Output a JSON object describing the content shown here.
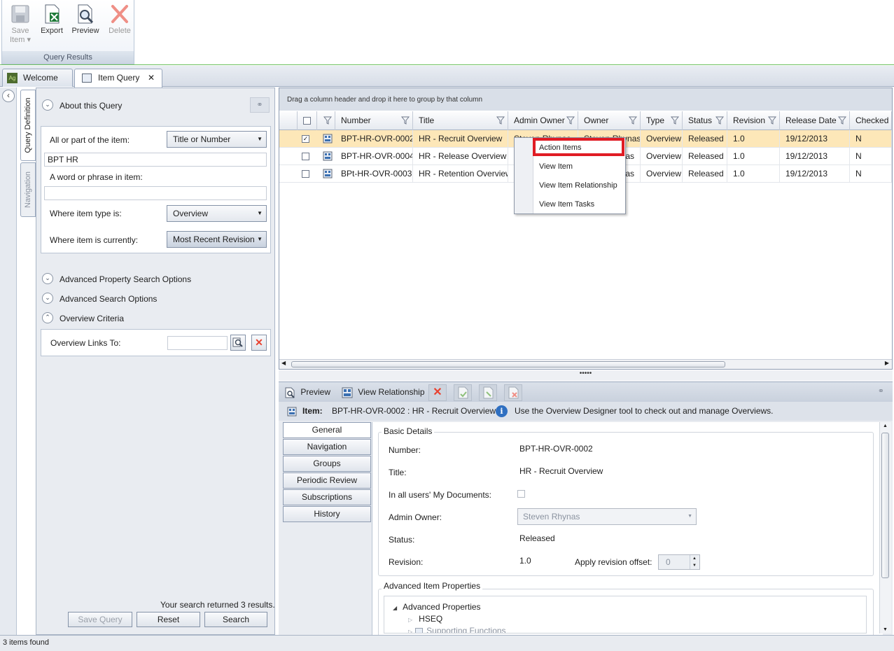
{
  "ribbon": {
    "buttons": [
      {
        "label": "Save\nItem ▾",
        "icon": "save-icon",
        "enabled": false
      },
      {
        "label": "Export",
        "icon": "excel-export-icon",
        "enabled": true
      },
      {
        "label": "Preview",
        "icon": "preview-icon",
        "enabled": true
      },
      {
        "label": "Delete",
        "icon": "delete-icon",
        "enabled": false
      }
    ],
    "save_label_1": "Save",
    "save_label_2": "Item ▾",
    "export_label": "Export",
    "preview_label": "Preview",
    "delete_label": "Delete",
    "group_caption": "Query Results"
  },
  "tabs": {
    "welcome": "Welcome",
    "item_query": "Item Query",
    "close_glyph": "✕"
  },
  "side_tabs": {
    "query_definition": "Query Definition",
    "navigation": "Navigation"
  },
  "query": {
    "about_title": "About this Query",
    "all_or_part_label": "All or part of the item:",
    "search_mode": "Title or Number",
    "search_value": "BPT HR",
    "word_phrase_label": "A word or phrase in item:",
    "word_phrase_value": "",
    "item_type_label": "Where item type is:",
    "item_type_value": "Overview",
    "currently_label": "Where item is currently:",
    "currently_value": "Most Recent Revision",
    "adv_property": "Advanced Property Search Options",
    "adv_search": "Advanced Search Options",
    "overview_criteria": "Overview Criteria",
    "overview_links_label": "Overview Links To:",
    "result_text": "Your search returned 3 results.",
    "save_query": "Save Query",
    "reset": "Reset",
    "search": "Search"
  },
  "grid": {
    "group_hint": "Drag a column header and drop it here to group by that column",
    "columns": [
      "Number",
      "Title",
      "Admin Owner",
      "Owner",
      "Type",
      "Status",
      "Revision",
      "Release Date",
      "Checked C"
    ],
    "rows": [
      {
        "checked": true,
        "number": "BPT-HR-OVR-0002",
        "title": "HR - Recruit Overview",
        "admin_owner": "Steven Rhynas",
        "owner": "Steven Rhynas",
        "type": "Overview",
        "status": "Released",
        "revision": "1.0",
        "release_date": "19/12/2013",
        "checked_out": "N"
      },
      {
        "checked": false,
        "number": "BPT-HR-OVR-0004",
        "title": "HR - Release Overview",
        "admin_owner": "",
        "owner": "nas",
        "type": "Overview",
        "status": "Released",
        "revision": "1.0",
        "release_date": "19/12/2013",
        "checked_out": "N"
      },
      {
        "checked": false,
        "number": "BPt-HR-OVR-0003",
        "title": "HR - Retention Overview",
        "admin_owner": "",
        "owner": "nas",
        "type": "Overview",
        "status": "Released",
        "revision": "1.0",
        "release_date": "19/12/2013",
        "checked_out": "N"
      }
    ]
  },
  "context_menu": {
    "items": [
      "Action Items",
      "View Item",
      "View Item Relationship",
      "View Item Tasks"
    ]
  },
  "splitter_grip": "•••••",
  "detail": {
    "toolbar": {
      "preview": "Preview",
      "view_relationship": "View Relationship"
    },
    "item_label": "Item:",
    "item_value": "BPT-HR-OVR-0002 : HR - Recruit Overview",
    "info_text": "Use the Overview Designer tool to check out and manage Overviews.",
    "tabs": [
      "General",
      "Navigation",
      "Groups",
      "Periodic Review",
      "Subscriptions",
      "History"
    ],
    "basic_details": "Basic Details",
    "number_label": "Number:",
    "number_value": "BPT-HR-OVR-0002",
    "title_label": "Title:",
    "title_value": "HR - Recruit Overview",
    "mydocs_label": "In all users' My Documents:",
    "admin_owner_label": "Admin Owner:",
    "admin_owner_value": "Steven Rhynas",
    "status_label": "Status:",
    "status_value": "Released",
    "revision_label": "Revision:",
    "revision_value": "1.0",
    "offset_label": "Apply revision offset:",
    "offset_value": "0",
    "advanced_props_title": "Advanced Item Properties",
    "tree": [
      "Advanced Properties",
      "HSEQ",
      "Supporting Functions"
    ]
  },
  "status_bar": "3 items found",
  "colors": {
    "selected_row": "#fde7b8",
    "highlight": "#e01c24",
    "delete_red": "#e8412f"
  }
}
